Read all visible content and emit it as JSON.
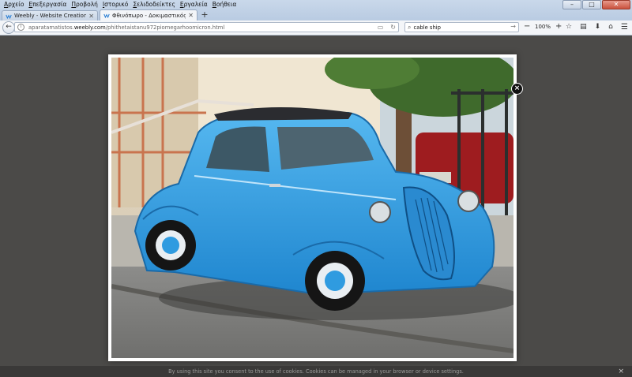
{
  "menu": [
    "Αρχείο",
    "Επεξεργασία",
    "Προβολή",
    "Ιστορικό",
    "Σελιδοδείκτες",
    "Εργαλεία",
    "Βοήθεια"
  ],
  "tabs": [
    {
      "title": "Weebly - Website Creation M",
      "active": false,
      "icon": "weebly-icon"
    },
    {
      "title": "Φθινόπωρο - Δοκιμαστικός",
      "active": true,
      "icon": "weebly-icon"
    }
  ],
  "new_tab": "+",
  "address": {
    "prefix": "aparatamatistos.",
    "host": "weebly.com",
    "path": "/phithetaistanu972piomegarhoomicron.html"
  },
  "search": {
    "value": "cable ship"
  },
  "zoom": {
    "minus": "−",
    "level": "100%",
    "plus": "+"
  },
  "cookie": {
    "text": "By using this site you consent to the use of cookies. Cookies can be managed in your browser or device settings.",
    "close": "×"
  },
  "lightbox": {
    "close": "×"
  },
  "colors": {
    "car": "#2f9be0",
    "page_bg": "#4b4a48",
    "chrome": "#c9d8ea"
  }
}
